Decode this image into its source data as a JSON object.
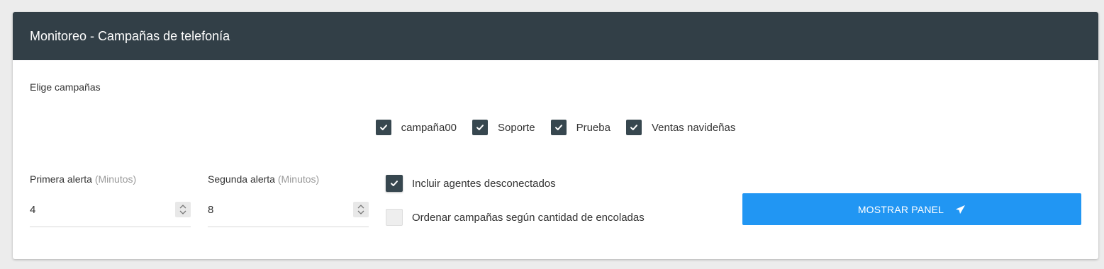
{
  "header": {
    "title": "Monitoreo - Campañas de telefonía"
  },
  "campaigns_section": {
    "label": "Elige campañas",
    "items": [
      {
        "label": "campaña00",
        "checked": true
      },
      {
        "label": "Soporte",
        "checked": true
      },
      {
        "label": "Prueba",
        "checked": true
      },
      {
        "label": "Ventas navideñas",
        "checked": true
      }
    ]
  },
  "first_alert": {
    "label": "Primera alerta",
    "unit": "(Minutos)",
    "value": "4"
  },
  "second_alert": {
    "label": "Segunda alerta",
    "unit": "(Minutos)",
    "value": "8"
  },
  "options": {
    "include_disconnected": {
      "label": "Incluir agentes desconectados",
      "checked": true
    },
    "order_by_queued": {
      "label": "Ordenar campañas según cantidad de encoladas",
      "checked": false
    }
  },
  "show_panel_button": {
    "label": "MOSTRAR PANEL",
    "icon": "send-icon"
  },
  "colors": {
    "header_bg": "#323f47",
    "checkbox": "#37474f",
    "button": "#2196f3"
  }
}
